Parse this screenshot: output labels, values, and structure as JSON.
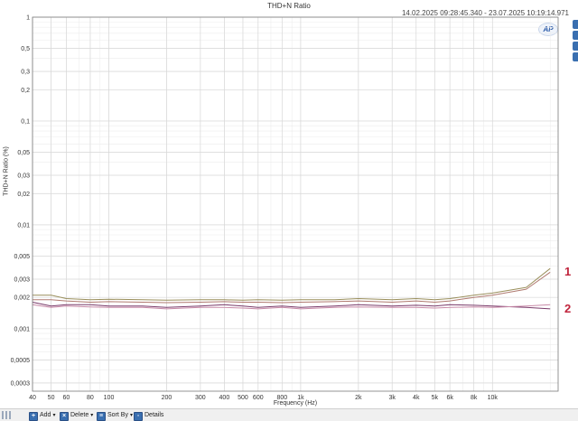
{
  "window": {
    "title": "THD+N Ratio",
    "timestamp": "14.02.2025 09:28:45.340 - 23.07.2025 10:19:14.971",
    "logo": "AP"
  },
  "toolbar": {
    "add_label": "Add",
    "delete_label": "Delete",
    "sortby_label": "Sort By",
    "details_label": "Details",
    "icons": [
      "add-icon",
      "delete-icon",
      "sort-icon",
      "details-icon"
    ]
  },
  "chart_data": {
    "type": "line",
    "title": "THD+N Ratio",
    "xlabel": "Frequency (Hz)",
    "ylabel": "THD+N Ratio (%)",
    "x_scale": "log",
    "y_scale": "log",
    "xlim": [
      40,
      22000
    ],
    "ylim": [
      0.00025,
      1
    ],
    "grid": true,
    "x_ticks": [
      40,
      50,
      60,
      80,
      100,
      200,
      300,
      400,
      500,
      600,
      800,
      1000,
      2000,
      3000,
      4000,
      5000,
      6000,
      8000,
      10000
    ],
    "x_tick_labels": [
      "40",
      "50",
      "60",
      "80",
      "100",
      "200",
      "300",
      "400",
      "500",
      "600",
      "800",
      "1k",
      "2k",
      "3k",
      "4k",
      "5k",
      "6k",
      "8k",
      "10k"
    ],
    "y_ticks": [
      1,
      0.5,
      0.3,
      0.2,
      0.1,
      0.05,
      0.03,
      0.02,
      0.01,
      0.005,
      0.003,
      0.002,
      0.001,
      0.0005,
      0.0003
    ],
    "y_tick_labels": [
      "1",
      "0,5",
      "0,3",
      "0,2",
      "0,1",
      "0,05",
      "0,03",
      "0,02",
      "0,01",
      "0,005",
      "0,003",
      "0,002",
      "0,001",
      "0,0005",
      "0,0003"
    ],
    "annotations": [
      {
        "text": "1",
        "color": "#c0243c"
      },
      {
        "text": "2",
        "color": "#c0243c"
      }
    ],
    "series": [
      {
        "color": "#9a8f5c",
        "x": [
          40,
          50,
          60,
          80,
          100,
          150,
          200,
          300,
          400,
          500,
          600,
          800,
          1000,
          1500,
          2000,
          3000,
          4000,
          5000,
          6000,
          8000,
          10000,
          15000,
          20000
        ],
        "y": [
          0.0021,
          0.0021,
          0.00195,
          0.0019,
          0.00192,
          0.0019,
          0.00188,
          0.0019,
          0.0019,
          0.00188,
          0.0019,
          0.00188,
          0.0019,
          0.0019,
          0.00195,
          0.0019,
          0.00195,
          0.0019,
          0.00195,
          0.0021,
          0.0022,
          0.0025,
          0.0038
        ]
      },
      {
        "color": "#b07a70",
        "x": [
          40,
          50,
          60,
          80,
          100,
          150,
          200,
          300,
          400,
          500,
          600,
          800,
          1000,
          1500,
          2000,
          3000,
          4000,
          5000,
          6000,
          8000,
          10000,
          15000,
          20000
        ],
        "y": [
          0.0019,
          0.0019,
          0.00185,
          0.0018,
          0.00182,
          0.0018,
          0.00178,
          0.0018,
          0.00182,
          0.0018,
          0.0018,
          0.00178,
          0.0018,
          0.00182,
          0.00185,
          0.0018,
          0.00185,
          0.0018,
          0.00185,
          0.002,
          0.0021,
          0.0024,
          0.0035
        ]
      },
      {
        "color": "#7a3b6a",
        "x": [
          40,
          50,
          60,
          80,
          100,
          150,
          200,
          300,
          400,
          500,
          600,
          800,
          1000,
          1500,
          2000,
          3000,
          4000,
          5000,
          6000,
          8000,
          10000,
          15000,
          20000
        ],
        "y": [
          0.0018,
          0.00165,
          0.0017,
          0.0017,
          0.00165,
          0.00165,
          0.0016,
          0.00165,
          0.0017,
          0.00165,
          0.0016,
          0.00165,
          0.0016,
          0.00165,
          0.0017,
          0.00165,
          0.00168,
          0.00165,
          0.0017,
          0.00168,
          0.00165,
          0.0016,
          0.00155
        ]
      },
      {
        "color": "#c88aa8",
        "x": [
          40,
          50,
          60,
          80,
          100,
          150,
          200,
          300,
          400,
          500,
          600,
          800,
          1000,
          1500,
          2000,
          3000,
          4000,
          5000,
          6000,
          8000,
          10000,
          15000,
          20000
        ],
        "y": [
          0.0017,
          0.0016,
          0.00165,
          0.00162,
          0.0016,
          0.0016,
          0.00155,
          0.0016,
          0.0016,
          0.00158,
          0.00155,
          0.0016,
          0.00155,
          0.0016,
          0.00162,
          0.0016,
          0.0016,
          0.00158,
          0.0016,
          0.00162,
          0.0016,
          0.00165,
          0.0017
        ]
      }
    ]
  }
}
